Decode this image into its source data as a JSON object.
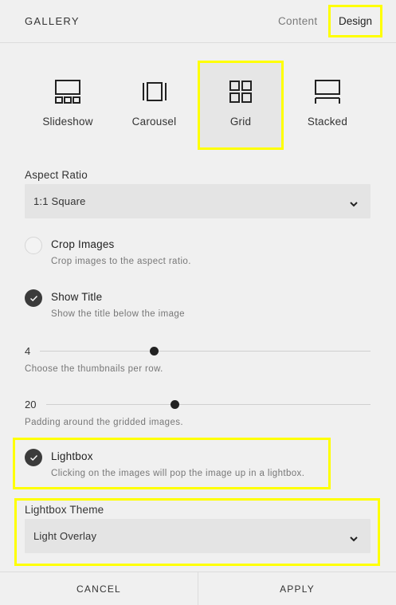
{
  "header": {
    "title": "GALLERY",
    "tabs": [
      "Content",
      "Design"
    ],
    "active_tab": "Design"
  },
  "layouts": [
    {
      "label": "Slideshow",
      "icon": "slideshow-icon",
      "selected": false
    },
    {
      "label": "Carousel",
      "icon": "carousel-icon",
      "selected": false
    },
    {
      "label": "Grid",
      "icon": "grid-icon",
      "selected": true
    },
    {
      "label": "Stacked",
      "icon": "stacked-icon",
      "selected": false
    }
  ],
  "aspect_ratio": {
    "label": "Aspect Ratio",
    "value": "1:1 Square"
  },
  "crop_images": {
    "title": "Crop Images",
    "desc": "Crop images to the aspect ratio.",
    "checked": false
  },
  "show_title": {
    "title": "Show Title",
    "desc": "Show the title below the image",
    "checked": true
  },
  "thumbnails": {
    "value": "4",
    "help": "Choose the thumbnails per row."
  },
  "padding": {
    "value": "20",
    "help": "Padding around the gridded images."
  },
  "lightbox": {
    "title": "Lightbox",
    "desc": "Clicking on the images will pop the image up in a lightbox.",
    "checked": true
  },
  "lightbox_theme": {
    "label": "Lightbox Theme",
    "value": "Light Overlay"
  },
  "footer": {
    "cancel": "CANCEL",
    "apply": "APPLY"
  },
  "colors": {
    "highlight": "#ffff00",
    "checked_fill": "#3b3b3b",
    "background": "#f0f0f0",
    "select_bg": "#e4e4e4"
  }
}
